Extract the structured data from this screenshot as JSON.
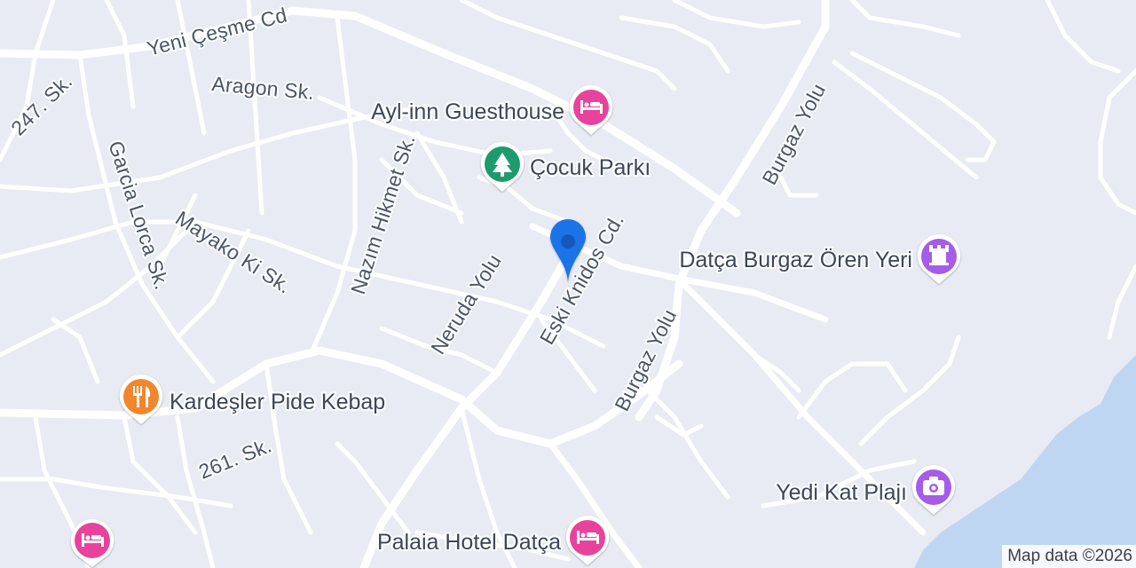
{
  "map": {
    "water_color": "#bfd6f2",
    "land_color": "#e8ebf3",
    "road_color": "#ffffff",
    "streets": {
      "yeni_cesme": "Yeni Çeşme Cd",
      "aragon": "Aragon Sk.",
      "s247": "247. Sk.",
      "garcia_lorca": "Garcia Lorca Sk.",
      "nazim_hikmet": "Nazım Hikmet Sk.",
      "mayako": "Mayako Ki Sk.",
      "neruda": "Neruda Yolu",
      "eski_knidos": "Eski Knidos Cd.",
      "burgaz_yolu_1": "Burgaz Yolu",
      "burgaz_yolu_2": "Burgaz Yolu",
      "s261": "261. Sk."
    },
    "pois": [
      {
        "label": "Ayl-inn Guesthouse",
        "icon": "hotel-bed-icon",
        "color": "#e8439c"
      },
      {
        "label": "Çocuk Parkı",
        "icon": "park-tree-icon",
        "color": "#1e9b6c"
      },
      {
        "label": "Datça Burgaz Ören Yeri",
        "icon": "historic-castle-icon",
        "color": "#a55ce6"
      },
      {
        "label": "Kardeşler Pide Kebap",
        "icon": "restaurant-fork-knife-icon",
        "color": "#f2862d"
      },
      {
        "label": "Yedi Kat Plajı",
        "icon": "camera-attraction-icon",
        "color": "#a55ce6"
      },
      {
        "label": "Palaia Hotel Datça",
        "icon": "hotel-bed-icon",
        "color": "#e8439c"
      },
      {
        "label": "",
        "icon": "hotel-bed-icon",
        "color": "#e8439c"
      }
    ],
    "location_marker": {
      "icon": "location-pin-icon",
      "color": "#1a73e8"
    },
    "attribution": "Map data ©2026"
  }
}
